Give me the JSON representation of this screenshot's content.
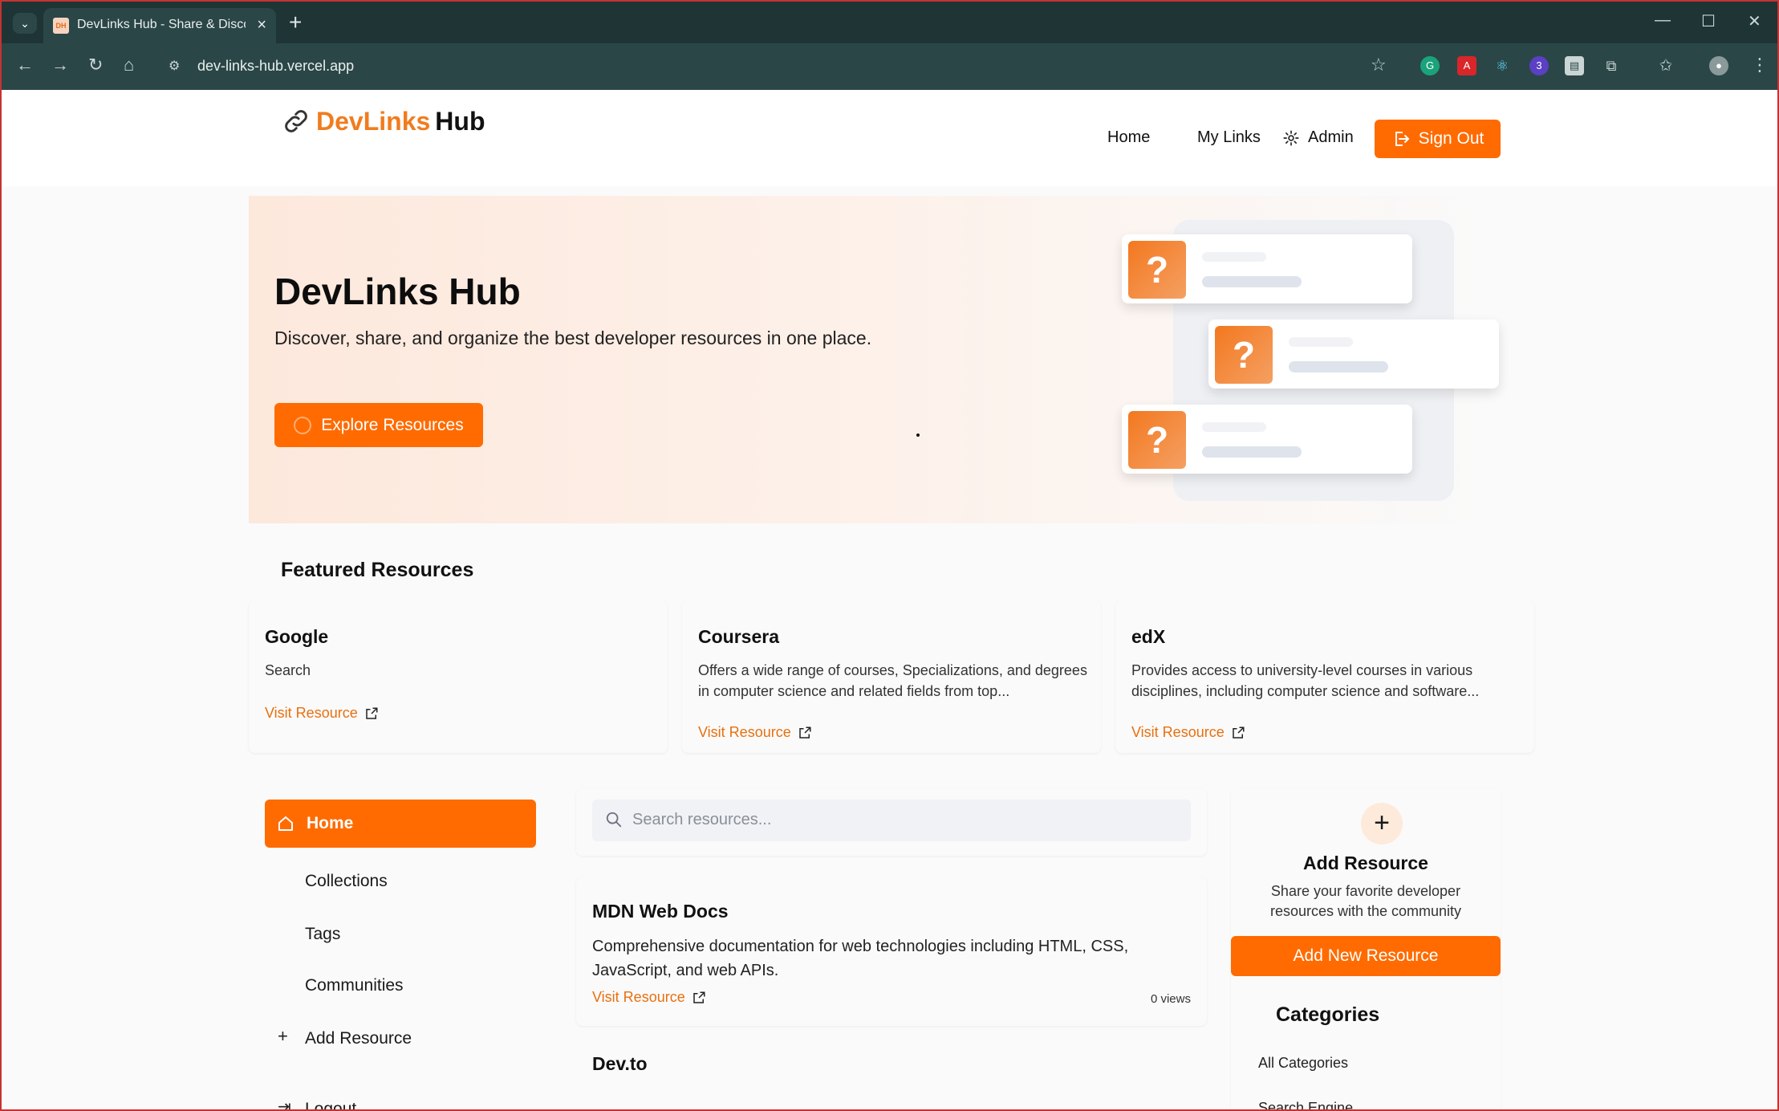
{
  "browser": {
    "tab_title": "DevLinks Hub - Share & Discover",
    "tab_favicon": "DH",
    "url": "dev-links-hub.vercel.app",
    "extension_badge": "3"
  },
  "header": {
    "logo_dev": "DevLinks",
    "logo_hub": "Hub",
    "nav_home": "Home",
    "nav_mylinks": "My Links",
    "nav_admin": "Admin",
    "signout_label": "Sign Out"
  },
  "hero": {
    "title": "DevLinks Hub",
    "subtitle": "Discover, share, and organize the best developer resources in one place.",
    "explore_label": "Explore Resources",
    "question_mark": "?"
  },
  "featured": {
    "title": "Featured Resources",
    "cards": [
      {
        "name": "Google",
        "desc": "Search",
        "link": "Visit Resource"
      },
      {
        "name": "Coursera",
        "desc": "Offers a wide range of courses, Specializations, and degrees in computer science and related fields from top...",
        "link": "Visit Resource"
      },
      {
        "name": "edX",
        "desc": "Provides access to university-level courses in various disciplines, including computer science and software...",
        "link": "Visit Resource"
      }
    ]
  },
  "sidebar": {
    "home": "Home",
    "collections": "Collections",
    "tags": "Tags",
    "communities": "Communities",
    "add_resource": "Add Resource",
    "logout": "Logout"
  },
  "search": {
    "placeholder": "Search resources..."
  },
  "resources": [
    {
      "name": "MDN Web Docs",
      "desc": "Comprehensive documentation for web technologies including HTML, CSS, JavaScript, and web APIs.",
      "link": "Visit Resource",
      "views": "0 views"
    },
    {
      "name": "Dev.to"
    }
  ],
  "add_panel": {
    "title": "Add Resource",
    "subtitle": "Share your favorite developer resources with the community",
    "button": "Add New Resource"
  },
  "categories": {
    "title": "Categories",
    "items": [
      "All Categories",
      "Search Engine"
    ]
  },
  "colors": {
    "accent": "#ff6b00",
    "chrome": "#2b4647",
    "link": "#e8700f"
  }
}
